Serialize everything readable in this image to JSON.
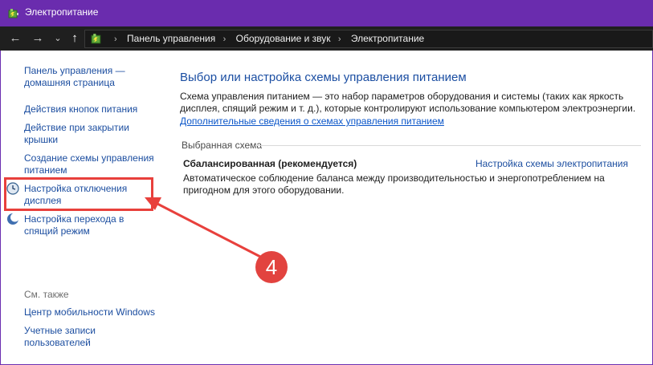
{
  "window": {
    "title": "Электропитание"
  },
  "nav": {
    "back": "←",
    "forward": "→",
    "dropdown": "⌄",
    "up": "↑"
  },
  "breadcrumb": [
    "Панель управления",
    "Оборудование и звук",
    "Электропитание"
  ],
  "breadcrumb_separator": "›",
  "sidebar": {
    "home_line1": "Панель управления —",
    "home_line2": "домашняя страница",
    "power_buttons": "Действия кнопок питания",
    "lid_line1": "Действие при закрытии",
    "lid_line2": "крышки",
    "create_line1": "Создание схемы управления",
    "create_line2": "питанием",
    "display_line1": "Настройка отключения",
    "display_line2": "дисплея",
    "sleep_line1": "Настройка перехода в",
    "sleep_line2": "спящий режим",
    "see_also": "См. также",
    "mobility": "Центр мобильности Windows",
    "accounts_line1": "Учетные записи",
    "accounts_line2": "пользователей"
  },
  "main": {
    "title": "Выбор или настройка схемы управления питанием",
    "desc_line1": "Схема управления питанием — это набор параметров оборудования и системы (таких как яркость",
    "desc_line2": "дисплея, спящий режим и т. д.), которые контролируют использование компьютером электроэнергии.",
    "more_link": "Дополнительные сведения о схемах управления питанием",
    "selected_label": "Выбранная схема",
    "plan_name": "Сбалансированная (рекомендуется)",
    "plan_settings_link": "Настройка схемы электропитания",
    "plan_desc_line1": "Автоматическое соблюдение баланса между производительностью и энергопотреблением на",
    "plan_desc_line2": "пригодном для этого оборудовании."
  },
  "annotation": {
    "number": "4"
  },
  "colors": {
    "titlebar": "#6a2cae",
    "navbar": "#1f1f1f",
    "link": "#1c4ea0",
    "annotation": "#e2433f"
  }
}
